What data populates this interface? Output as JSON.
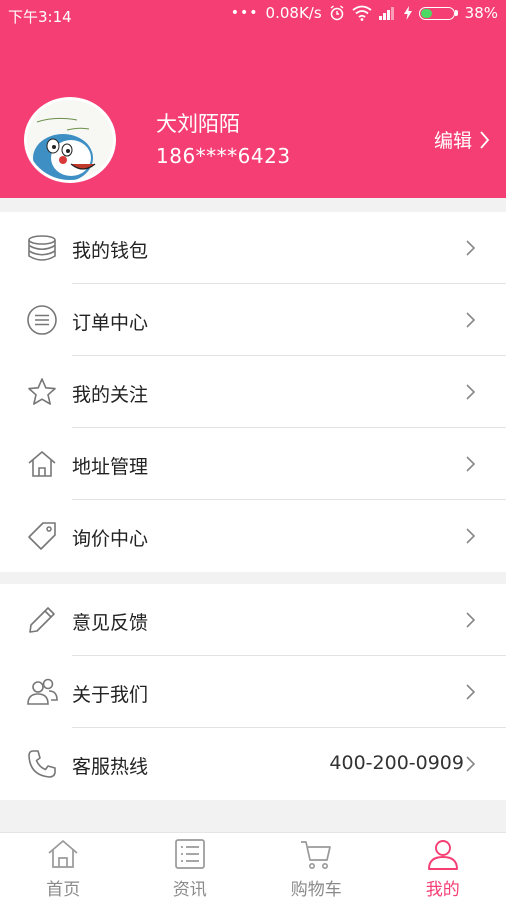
{
  "colors": {
    "brand": "#f53f74",
    "battery": "#4cd964",
    "icon": "#777777"
  },
  "status_bar": {
    "time": "下午3:14",
    "dots": "•••",
    "speed": "0.08K/s",
    "battery": "38%",
    "battery_level": 0.38
  },
  "profile": {
    "name": "大刘陌陌",
    "phone": "186****6423",
    "edit_label": "编辑"
  },
  "menu_group_1": [
    {
      "label": "我的钱包",
      "icon": "wallet-icon"
    },
    {
      "label": "订单中心",
      "icon": "list-icon"
    },
    {
      "label": "我的关注",
      "icon": "star-icon"
    },
    {
      "label": "地址管理",
      "icon": "home-icon"
    },
    {
      "label": "询价中心",
      "icon": "tag-icon"
    }
  ],
  "menu_group_2": [
    {
      "label": "意见反馈",
      "icon": "pencil-icon"
    },
    {
      "label": "关于我们",
      "icon": "people-icon"
    },
    {
      "label": "客服热线",
      "icon": "phone-icon",
      "value": "400-200-0909"
    }
  ],
  "tabbar": [
    {
      "label": "首页",
      "icon": "home-tab-icon",
      "active": false
    },
    {
      "label": "资讯",
      "icon": "news-icon",
      "active": false
    },
    {
      "label": "购物车",
      "icon": "cart-icon",
      "active": false
    },
    {
      "label": "我的",
      "icon": "profile-icon",
      "active": true
    }
  ]
}
